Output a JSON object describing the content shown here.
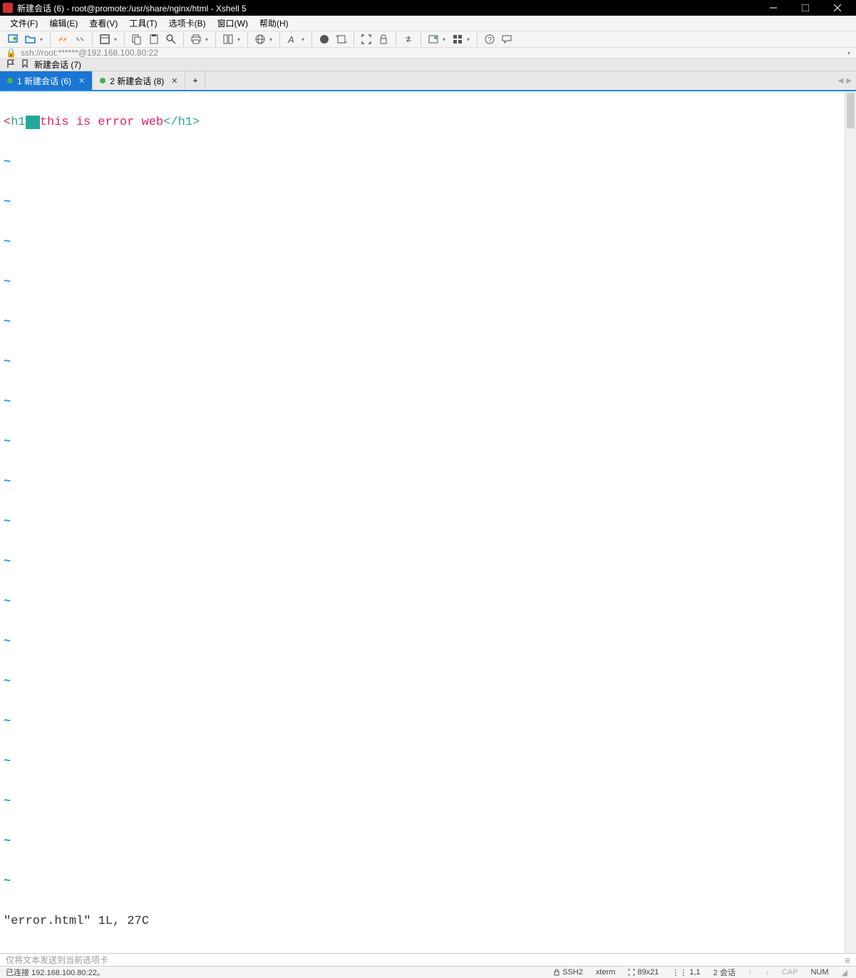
{
  "title": "新建会话 (6) - root@promote:/usr/share/nginx/html - Xshell 5",
  "menus": {
    "file": "文件(F)",
    "edit": "编辑(E)",
    "view": "查看(V)",
    "tools": "工具(T)",
    "tab": "选项卡(B)",
    "window": "窗口(W)",
    "help": "帮助(H)"
  },
  "address": "ssh://root:******@192.168.100.80:22",
  "session_label": "新建会话 (7)",
  "tabs": [
    {
      "label": "1 新建会话 (6)",
      "active": true
    },
    {
      "label": "2 新建会话 (8)",
      "active": false
    }
  ],
  "terminal": {
    "tag_open_lt": "<",
    "tag_name": "h1",
    "content": "this is error web",
    "tag_close": "</h1>",
    "tilde": "~",
    "status": "\"error.html\" 1L, 27C"
  },
  "input_placeholder": "仅将文本发送到当前选项卡",
  "status": {
    "conn": "已连接 192.168.100.80:22。",
    "proto": "SSH2",
    "term": "xterm",
    "size": "89x21",
    "pos": "1,1",
    "sessions": "2 会话",
    "cap": "CAP",
    "num": "NUM"
  }
}
